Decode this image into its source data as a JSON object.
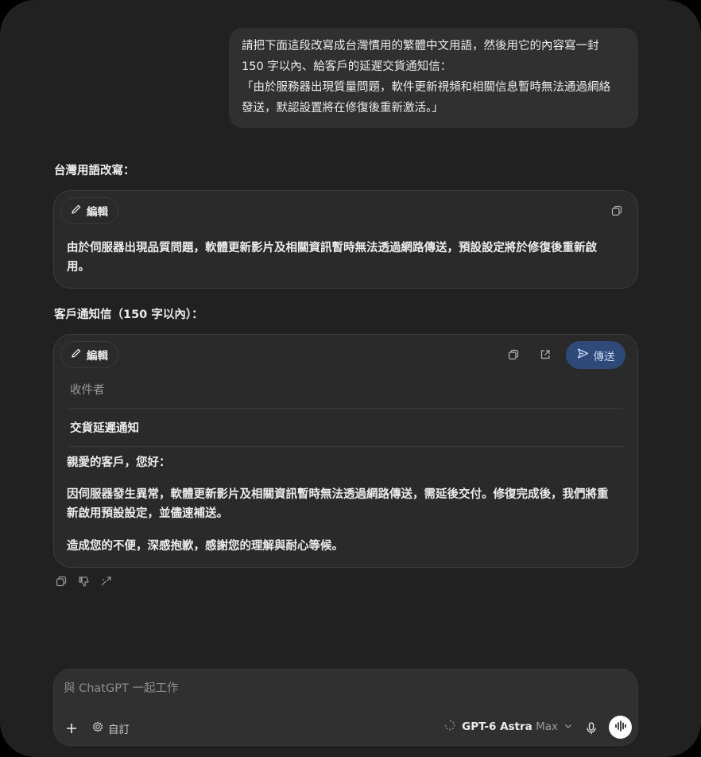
{
  "user_message": "請把下面這段改寫成台灣慣用的繁體中文用語，然後用它的內容寫一封\n150 字以內、給客戶的延遲交貨通知信：\n「由於服務器出現質量問題，軟件更新視頻和相關信息暫時無法通過網絡\n發送，默認設置將在修復後重新激活。」",
  "section1": {
    "label": "台灣用語改寫：",
    "edit_label": "編輯",
    "text": "由於伺服器出現品質問題，軟體更新影片及相關資訊暫時無法透過網路傳送，預設設定將於修復後重新啟用。"
  },
  "section2": {
    "label": "客戶通知信（150 字以內）：",
    "edit_label": "編輯",
    "send_label": "傳送",
    "recipient_placeholder": "收件者",
    "subject": "交貨延遲通知",
    "greeting": "親愛的客戶，您好：",
    "body": "因伺服器發生異常，軟體更新影片及相關資訊暫時無法透過網路傳送，需延後交付。修復完成後，我們將重新啟用預設設定，並儘速補送。",
    "closing": "造成您的不便，深感抱歉，感謝您的理解與耐心等候。"
  },
  "composer": {
    "placeholder": "與 ChatGPT 一起工作",
    "custom_label": "自訂",
    "model_name": "GPT-6 Astra",
    "model_suffix": "Max"
  },
  "icons": {
    "edit": "pencil-icon",
    "copy": "copy-icon",
    "open": "external-link-icon",
    "send": "send-icon",
    "thumbs_down": "thumbs-down-icon",
    "share": "share-icon",
    "plus": "plus-icon",
    "settings": "gear-icon",
    "mic": "mic-icon",
    "voice": "voice-wave-icon"
  },
  "colors": {
    "background": "#212121",
    "bubble": "#303030",
    "card": "#2a2a2a",
    "send_button": "#2f4a78"
  }
}
